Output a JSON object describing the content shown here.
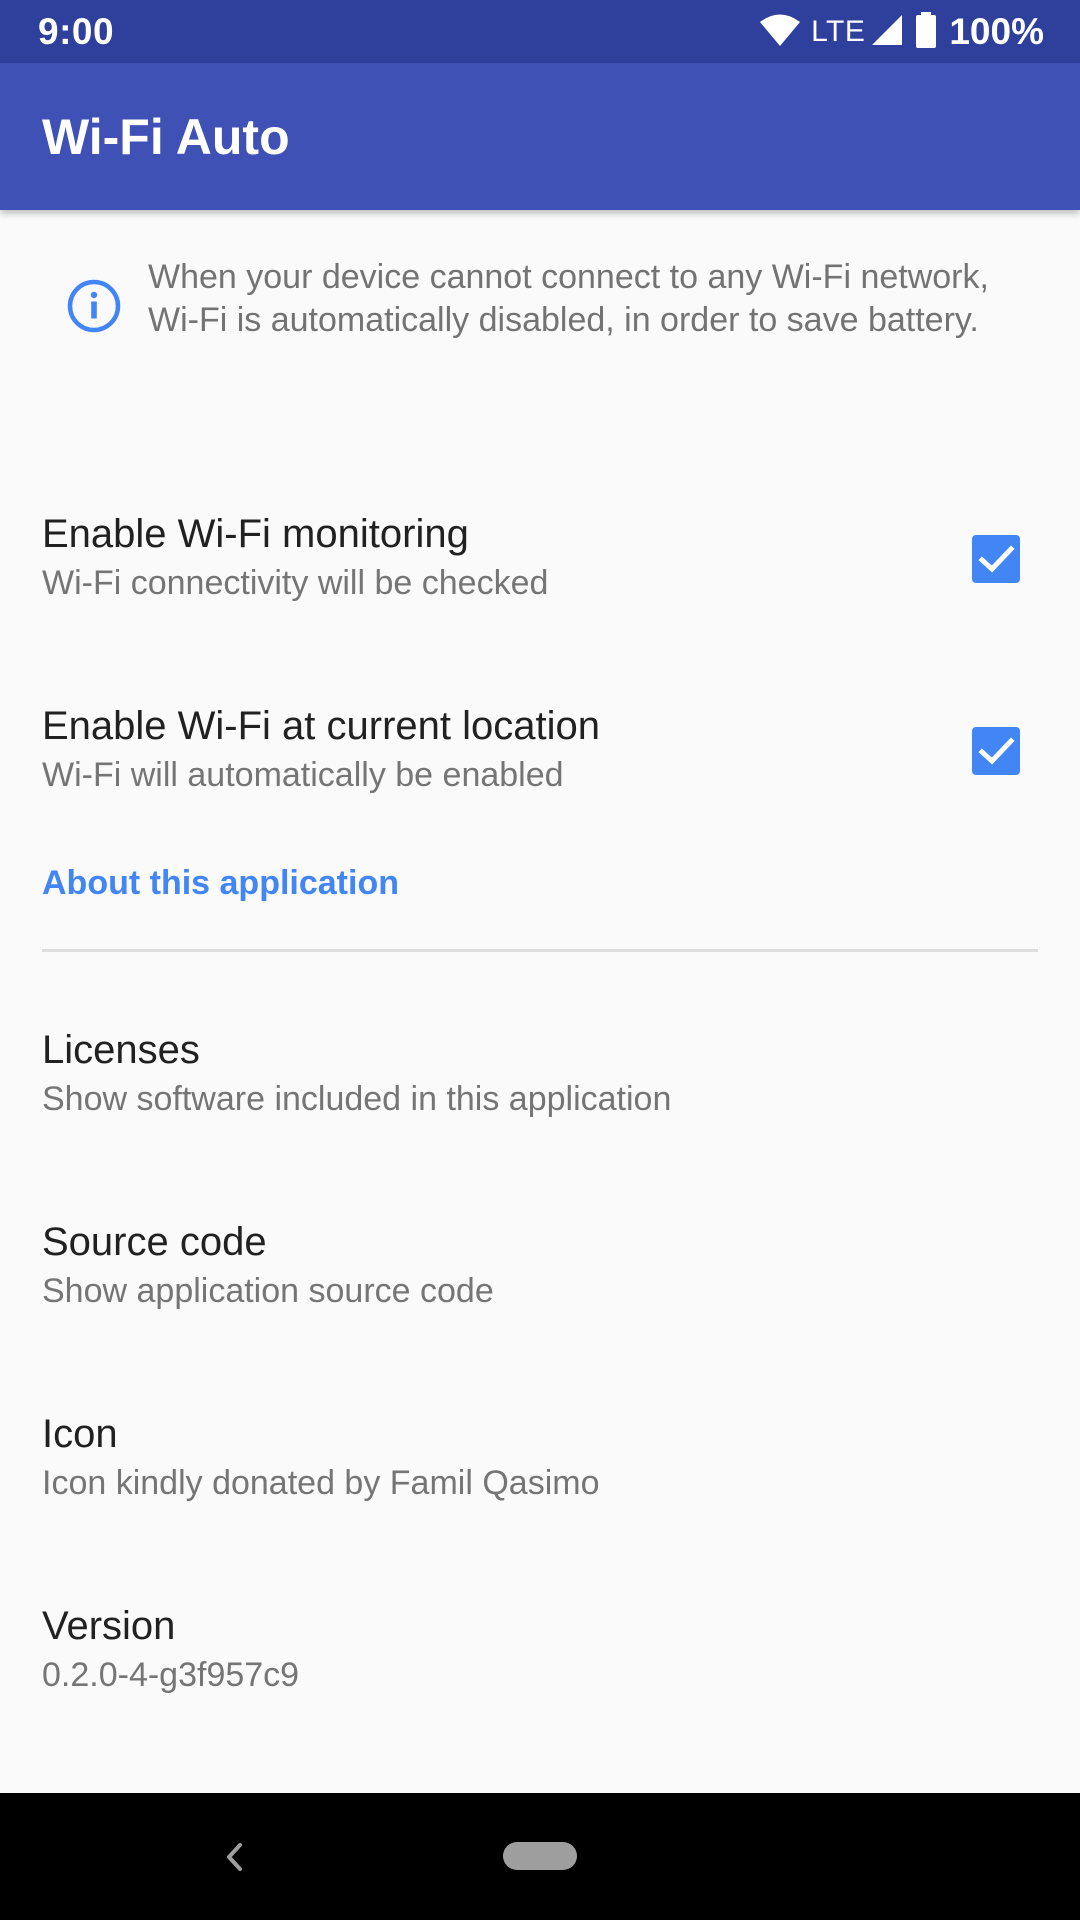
{
  "status_bar": {
    "time": "9:00",
    "network": "LTE",
    "battery": "100%",
    "icons": [
      "wifi-icon",
      "cell-signal-icon",
      "battery-icon"
    ]
  },
  "app_bar": {
    "title": "Wi-Fi Auto",
    "color": "#3f51b5"
  },
  "info": {
    "icon": "info-icon",
    "text": "When your device cannot connect to any Wi-Fi network, Wi-Fi is automatically disabled, in order to save battery."
  },
  "preferences": [
    {
      "title": "Enable Wi-Fi monitoring",
      "summary": "Wi-Fi connectivity will be checked",
      "checked": true
    },
    {
      "title": "Enable Wi-Fi at current location",
      "summary": "Wi-Fi will automatically be enabled",
      "checked": true
    }
  ],
  "about": {
    "category_title": "About this application",
    "items": [
      {
        "title": "Licenses",
        "summary": "Show software included in this application"
      },
      {
        "title": "Source code",
        "summary": "Show application source code"
      },
      {
        "title": "Icon",
        "summary": "Icon kindly donated by Famil Qasimo"
      },
      {
        "title": "Version",
        "summary": "0.2.0-4-g3f957c9"
      }
    ]
  },
  "colors": {
    "accent": "#4285f4",
    "status_bar": "#2f3f9c",
    "background": "#fafafa"
  },
  "nav_bar": {
    "icons": [
      "back-icon",
      "home-pill-icon"
    ]
  }
}
